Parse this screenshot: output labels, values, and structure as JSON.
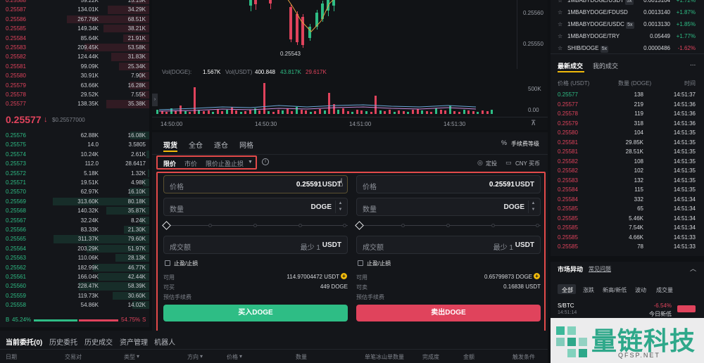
{
  "orderbook": {
    "asks": [
      {
        "price": "0.25588",
        "amount": "59.22K",
        "total": "15.15K"
      },
      {
        "price": "0.25587",
        "amount": "134.01K",
        "total": "34.29K"
      },
      {
        "price": "0.25586",
        "amount": "267.76K",
        "total": "68.51K"
      },
      {
        "price": "0.25585",
        "amount": "149.34K",
        "total": "38.21K"
      },
      {
        "price": "0.25584",
        "amount": "85.64K",
        "total": "21.91K"
      },
      {
        "price": "0.25583",
        "amount": "209.45K",
        "total": "53.58K"
      },
      {
        "price": "0.25582",
        "amount": "124.44K",
        "total": "31.83K"
      },
      {
        "price": "0.25581",
        "amount": "99.09K",
        "total": "25.34K"
      },
      {
        "price": "0.25580",
        "amount": "30.91K",
        "total": "7.90K"
      },
      {
        "price": "0.25579",
        "amount": "63.66K",
        "total": "16.28K"
      },
      {
        "price": "0.25578",
        "amount": "29.52K",
        "total": "7.55K"
      },
      {
        "price": "0.25577",
        "amount": "138.35K",
        "total": "35.38K"
      }
    ],
    "last_price": "0.25577",
    "last_price_arrow": "↓",
    "last_price_fiat": "$0.25577000",
    "bids": [
      {
        "price": "0.25576",
        "amount": "62.88K",
        "total": "16.08K"
      },
      {
        "price": "0.25575",
        "amount": "14.0",
        "total": "3.5805"
      },
      {
        "price": "0.25574",
        "amount": "10.24K",
        "total": "2.61K"
      },
      {
        "price": "0.25573",
        "amount": "112.0",
        "total": "28.6417"
      },
      {
        "price": "0.25572",
        "amount": "5.18K",
        "total": "1.32K"
      },
      {
        "price": "0.25571",
        "amount": "19.51K",
        "total": "4.98K"
      },
      {
        "price": "0.25570",
        "amount": "62.97K",
        "total": "16.10K"
      },
      {
        "price": "0.25569",
        "amount": "313.60K",
        "total": "80.18K"
      },
      {
        "price": "0.25568",
        "amount": "140.32K",
        "total": "35.87K"
      },
      {
        "price": "0.25567",
        "amount": "32.24K",
        "total": "8.24K"
      },
      {
        "price": "0.25566",
        "amount": "83.33K",
        "total": "21.30K"
      },
      {
        "price": "0.25565",
        "amount": "311.37K",
        "total": "79.60K"
      },
      {
        "price": "0.25564",
        "amount": "203.29K",
        "total": "51.97K"
      },
      {
        "price": "0.25563",
        "amount": "110.06K",
        "total": "28.13K"
      },
      {
        "price": "0.25562",
        "amount": "182.99K",
        "total": "46.77K"
      },
      {
        "price": "0.25561",
        "amount": "166.04K",
        "total": "42.44K"
      },
      {
        "price": "0.25560",
        "amount": "228.47K",
        "total": "58.39K"
      },
      {
        "price": "0.25559",
        "amount": "119.73K",
        "total": "30.60K"
      },
      {
        "price": "0.25558",
        "amount": "54.86K",
        "total": "14.02K"
      }
    ],
    "ratio_buy_label": "B",
    "ratio_buy": "45.24%",
    "ratio_sell": "54.75%",
    "ratio_sell_label": "S"
  },
  "chart": {
    "price_low_label": "0.25543",
    "price_axis": [
      "0.25560",
      "0.25550"
    ],
    "vol_label": "Vol(DOGE):",
    "vol_doge": "1.567K",
    "vol_usdt_label": "Vol(USDT)",
    "vol_usdt": "400.848",
    "vol_green": "43.817K",
    "vol_red": "29.617K",
    "vol_axis": [
      "500K",
      "0.00"
    ],
    "time_axis": [
      "14:50:00",
      "14:50:30",
      "14:51:00",
      "14:51:30"
    ]
  },
  "trade": {
    "tabs": [
      "现货",
      "全仓",
      "逐仓",
      "网格"
    ],
    "fee_level": "手续费等级",
    "order_types": [
      "限价",
      "市价",
      "限价止盈止损"
    ],
    "info_icon": "info-icon",
    "fixed_invest": "定投",
    "cny_buy": "CNY 买币",
    "buy": {
      "price_label": "价格",
      "price": "0.25591",
      "price_unit": "USDT",
      "qty_label": "数量",
      "qty_unit": "DOGE",
      "total_label": "成交额",
      "total_min": "最少 1",
      "total_unit": "USDT",
      "tpsl": "止盈/止损",
      "avail_label": "可用",
      "avail": "114.97004472 USDT",
      "max_label": "可买",
      "max": "449 DOGE",
      "fee_label": "预估手续费",
      "button": "买入DOGE"
    },
    "sell": {
      "price_label": "价格",
      "price": "0.25591",
      "price_unit": "USDT",
      "qty_label": "数量",
      "qty_unit": "DOGE",
      "total_label": "成交额",
      "total_min": "最少 1",
      "total_unit": "USDT",
      "tpsl": "止盈/止损",
      "avail_label": "可用",
      "avail": "0.65799873 DOGE",
      "max_label": "可卖",
      "max": "0.16838 USDT",
      "fee_label": "预估手续费",
      "button": "卖出DOGE"
    }
  },
  "markets": [
    {
      "pair": "1MBABYDOGE/USDT",
      "lev": "5x",
      "price": "0.0013104",
      "change": "+1.72%"
    },
    {
      "pair": "1MBABYDOGE/FDUSD",
      "lev": "",
      "price": "0.0013140",
      "change": "+1.87%"
    },
    {
      "pair": "1MBABYDOGE/USDC",
      "lev": "5x",
      "price": "0.0013130",
      "change": "+1.85%"
    },
    {
      "pair": "1MBABYDOGE/TRY",
      "lev": "",
      "price": "0.05449",
      "change": "+1.77%"
    },
    {
      "pair": "SHIB/DOGE",
      "lev": "5x",
      "price": "0.0000486",
      "change": "-1.62%"
    }
  ],
  "trades_panel": {
    "tab_latest": "最新成交",
    "tab_mine": "我的成交",
    "more": "...",
    "col_price": "价格 (USDT)",
    "col_qty": "数量 (DOGE)",
    "col_time": "时间",
    "rows": [
      {
        "price": "0.25577",
        "qty": "138",
        "time": "14:51:37",
        "side": "buy"
      },
      {
        "price": "0.25577",
        "qty": "219",
        "time": "14:51:36",
        "side": "sell"
      },
      {
        "price": "0.25578",
        "qty": "119",
        "time": "14:51:36",
        "side": "sell"
      },
      {
        "price": "0.25579",
        "qty": "318",
        "time": "14:51:36",
        "side": "sell"
      },
      {
        "price": "0.25580",
        "qty": "104",
        "time": "14:51:35",
        "side": "sell"
      },
      {
        "price": "0.25581",
        "qty": "29.85K",
        "time": "14:51:35",
        "side": "sell"
      },
      {
        "price": "0.25581",
        "qty": "28.51K",
        "time": "14:51:35",
        "side": "sell"
      },
      {
        "price": "0.25582",
        "qty": "108",
        "time": "14:51:35",
        "side": "sell"
      },
      {
        "price": "0.25582",
        "qty": "102",
        "time": "14:51:35",
        "side": "sell"
      },
      {
        "price": "0.25583",
        "qty": "132",
        "time": "14:51:35",
        "side": "sell"
      },
      {
        "price": "0.25584",
        "qty": "115",
        "time": "14:51:35",
        "side": "sell"
      },
      {
        "price": "0.25584",
        "qty": "332",
        "time": "14:51:34",
        "side": "sell"
      },
      {
        "price": "0.25585",
        "qty": "65",
        "time": "14:51:34",
        "side": "sell"
      },
      {
        "price": "0.25585",
        "qty": "5.46K",
        "time": "14:51:34",
        "side": "sell"
      },
      {
        "price": "0.25585",
        "qty": "7.54K",
        "time": "14:51:34",
        "side": "sell"
      },
      {
        "price": "0.25585",
        "qty": "4.66K",
        "time": "14:51:33",
        "side": "sell"
      },
      {
        "price": "0.25585",
        "qty": "78",
        "time": "14:51:33",
        "side": "sell"
      }
    ]
  },
  "movers": {
    "title": "市场异动",
    "faq": "常见问题",
    "tabs": [
      "全部",
      "涨跌",
      "新高/新低",
      "波动",
      "成交量"
    ],
    "item_pair": "S/BTC",
    "item_time": "14:51:14",
    "item_change": "-6.54%",
    "item_desc": "今日新低"
  },
  "bottom": {
    "tabs": [
      "当前委托(0)",
      "历史委托",
      "历史成交",
      "资产管理",
      "机器人"
    ],
    "cols": [
      "日期",
      "交易对",
      "类型",
      "方向",
      "价格",
      "数量",
      "单笔冰山单数量",
      "完成度",
      "金额",
      "触发条件"
    ]
  },
  "watermark": {
    "brand": "量链科技",
    "domain": "QFSP.NET"
  },
  "colors": {
    "buy": "#2ebd85",
    "sell": "#e0435c",
    "highlight": "#e24a4a"
  }
}
